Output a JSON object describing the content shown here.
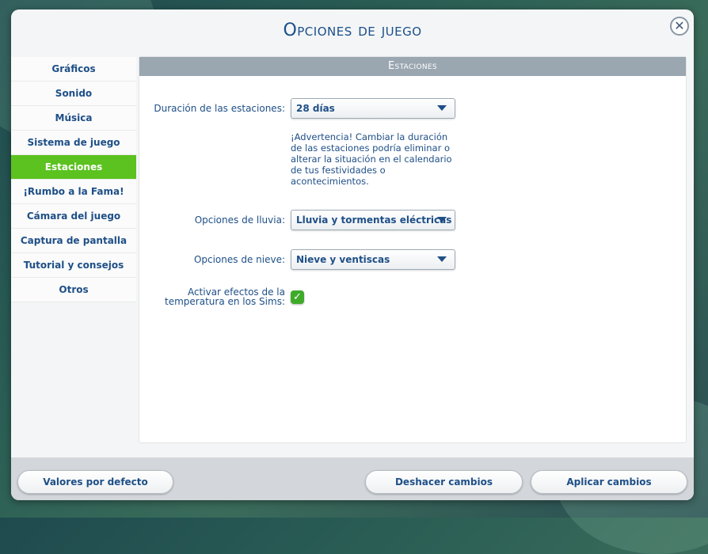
{
  "dialog": {
    "title": "Opciones de juego",
    "close_icon": "close-icon"
  },
  "sidebar": {
    "items": [
      {
        "label": "Gráficos",
        "active": false
      },
      {
        "label": "Sonido",
        "active": false
      },
      {
        "label": "Música",
        "active": false
      },
      {
        "label": "Sistema de juego",
        "active": false
      },
      {
        "label": "Estaciones",
        "active": true
      },
      {
        "label": "¡Rumbo a la Fama!",
        "active": false
      },
      {
        "label": "Cámara del juego",
        "active": false
      },
      {
        "label": "Captura de pantalla",
        "active": false
      },
      {
        "label": "Tutorial y consejos",
        "active": false
      },
      {
        "label": "Otros",
        "active": false
      }
    ],
    "active_color": "#5cc21f"
  },
  "panel": {
    "header": "Estaciones",
    "season_length": {
      "label": "Duración de las estaciones:",
      "value": "28 días",
      "warning": "¡Advertencia! Cambiar la duración de las estaciones podría eliminar o alterar la situación en el calendario de tus festividades o acontecimientos."
    },
    "rain": {
      "label": "Opciones de lluvia:",
      "value": "Lluvia y tormentas eléctricas"
    },
    "snow": {
      "label": "Opciones de nieve:",
      "value": "Nieve y ventiscas"
    },
    "temperature": {
      "label_line1": "Activar efectos de la",
      "label_line2": "temperatura en los Sims:",
      "checked": true,
      "check_icon": "checkmark-icon"
    }
  },
  "footer": {
    "defaults_label": "Valores por defecto",
    "undo_label": "Deshacer cambios",
    "apply_label": "Aplicar cambios"
  },
  "colors": {
    "title": "#1a4f8b",
    "text": "#1e4f87",
    "header_bg": "#9aa6b0",
    "checkbox": "#3faa2a"
  }
}
